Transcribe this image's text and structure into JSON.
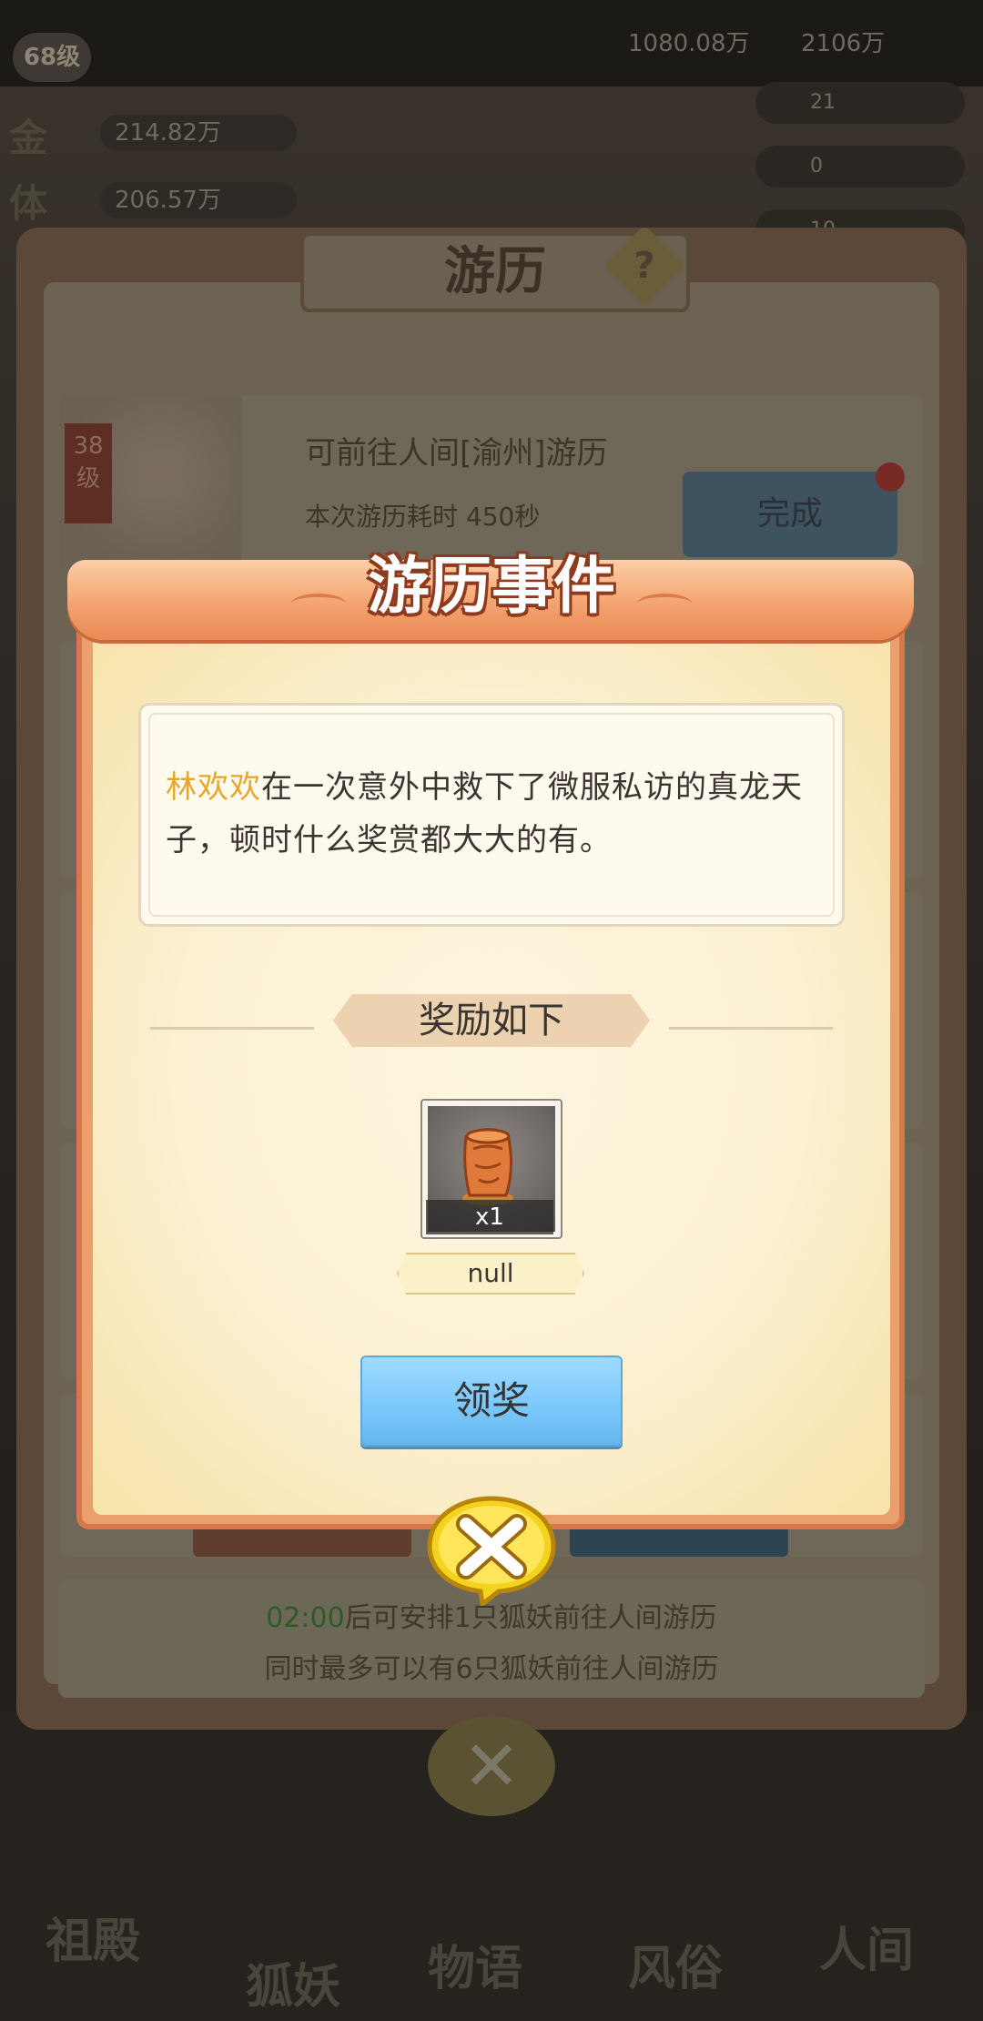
{
  "background": {
    "level_badge": "68级",
    "top_resources": [
      "1080.08万",
      "2106万"
    ],
    "resource_rows": [
      {
        "label": "金",
        "value": "214.82万"
      },
      {
        "label": "体",
        "value": "206.57万"
      }
    ],
    "side_stats": [
      "21",
      "0",
      "10"
    ],
    "panel": {
      "title": "游历",
      "help": "?",
      "trip": {
        "level": "38级",
        "destination": "可前往人间[渝州]游历",
        "duration": "本次游历耗时 450秒",
        "complete_label": "完成"
      },
      "info": {
        "countdown": "02:00",
        "line1_suffix": "后可安排1只狐妖前往人间游历",
        "line2": "同时最多可以有6只狐妖前往人间游历"
      }
    },
    "nav": [
      "祖殿",
      "狐妖",
      "物语",
      "风俗",
      "人间"
    ]
  },
  "modal": {
    "title": "游历事件",
    "story": {
      "name": "林欢欢",
      "text": "在一次意外中救下了微服私访的真龙天子，顿时什么奖赏都大大的有。"
    },
    "reward_header": "奖励如下",
    "reward": {
      "icon": "bronze-relic-icon",
      "count": "x1",
      "name": "null"
    },
    "claim_label": "领奖",
    "close_icon": "close-x-icon"
  },
  "colors": {
    "accent_name": "#e8a72a",
    "claim_button": "#7cc8fb",
    "frame_orange": "#e9a06c",
    "countdown_green": "#2e5a25"
  }
}
